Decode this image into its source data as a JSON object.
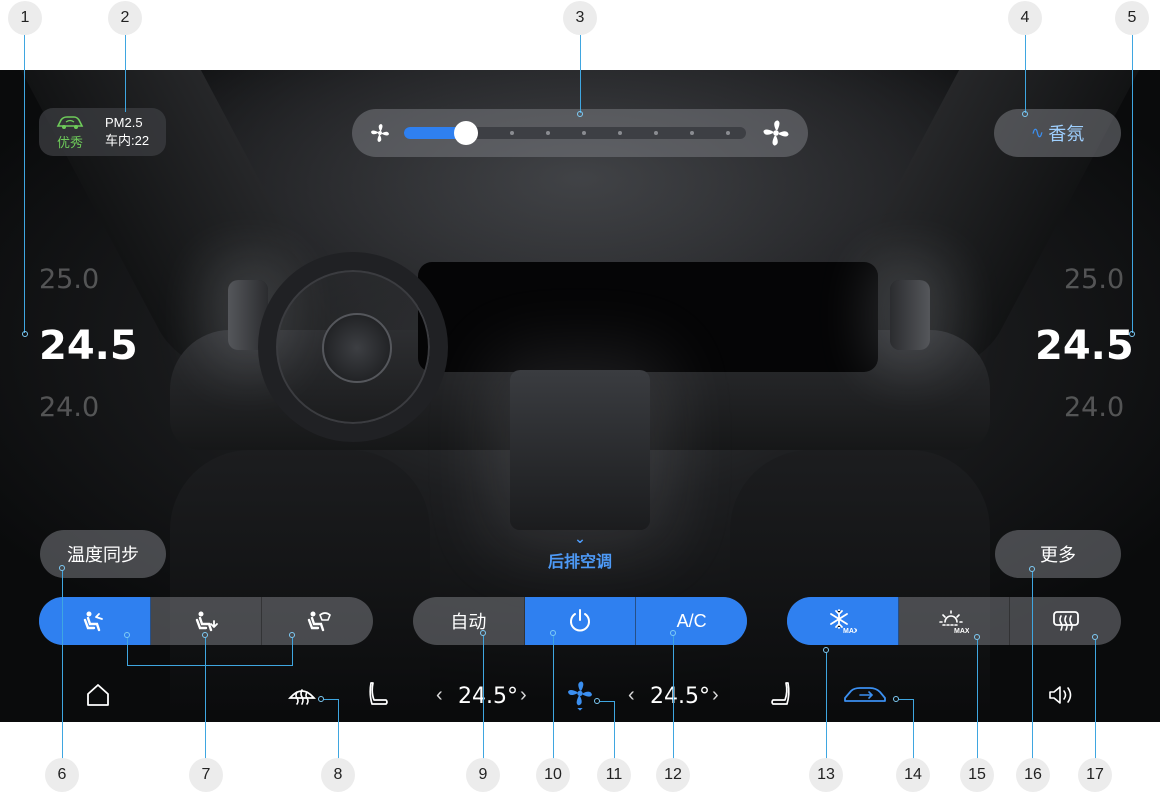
{
  "air_quality": {
    "quality_label": "优秀",
    "metric_label": "PM2.5",
    "inside_reading": "车内:22"
  },
  "fan": {
    "level": 2,
    "max_level": 9
  },
  "fragrance": {
    "label": "香氛"
  },
  "driver_temp": {
    "above": "25.0",
    "current": "24.5",
    "below": "24.0"
  },
  "passenger_temp": {
    "above": "25.0",
    "current": "24.5",
    "below": "24.0"
  },
  "buttons": {
    "temp_sync": "温度同步",
    "more": "更多",
    "rear_ac": "后排空调",
    "auto": "自动",
    "ac": "A/C"
  },
  "mode_group": {
    "selected_index": 0
  },
  "bottom_bar": {
    "left_temp": "24.5°",
    "right_temp": "24.5°"
  },
  "callouts": [
    "1",
    "2",
    "3",
    "4",
    "5",
    "6",
    "7",
    "8",
    "9",
    "10",
    "11",
    "12",
    "13",
    "14",
    "15",
    "16",
    "17"
  ],
  "colors": {
    "accent": "#2f80f0",
    "quality_good": "#6ecb5a",
    "callout_line": "#3fa6e0"
  }
}
